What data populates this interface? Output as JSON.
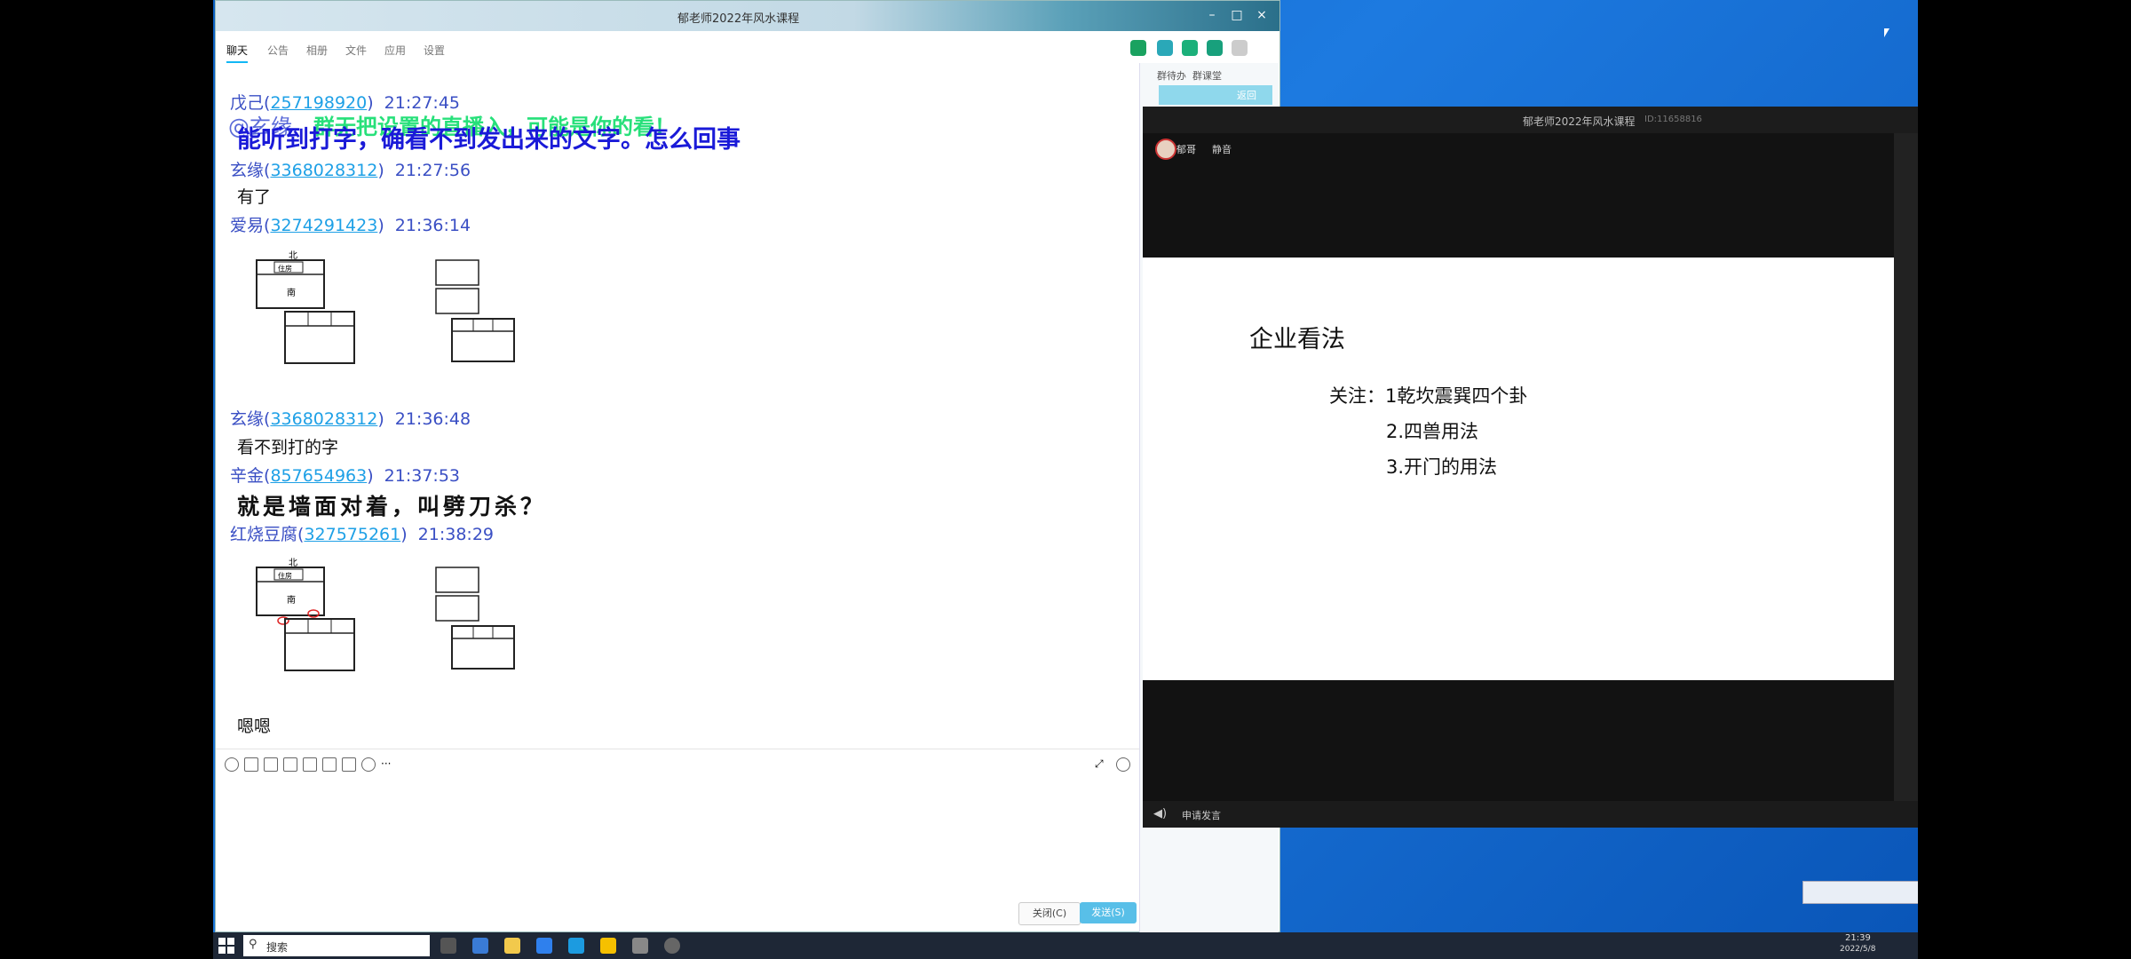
{
  "chat_window": {
    "title": "郁老师2022年风水课程",
    "tabs": [
      "聊天",
      "公告",
      "相册",
      "文件",
      "应用",
      "设置"
    ],
    "right_panel": {
      "tab1": "群待办",
      "tab2": "群课堂",
      "card_label": "返回"
    },
    "banner_mention": "@玄缘",
    "banner_text": "群无把设置的直播入，可能是你的看！",
    "messages": [
      {
        "sender": "戊己",
        "qq": "257198920",
        "time": "21:27:45",
        "text": "能听到打字，确看不到发出来的文字。怎么回事"
      },
      {
        "sender": "玄缘",
        "qq": "3368028312",
        "time": "21:27:56",
        "text": "有了"
      },
      {
        "sender": "爱易",
        "qq": "3274291423",
        "time": "21:36:14",
        "text": ""
      },
      {
        "sender": "玄缘",
        "qq": "3368028312",
        "time": "21:36:48",
        "text": "看不到打的字"
      },
      {
        "sender": "辛金",
        "qq": "857654963",
        "time": "21:37:53",
        "text": "就是墙面对着，叫劈刀杀？"
      },
      {
        "sender": "红烧豆腐",
        "qq": "327575261",
        "time": "21:38:29",
        "text": "嗯嗯"
      }
    ],
    "sketch_labels": {
      "north": "北",
      "south": "南",
      "inner": "住房"
    },
    "buttons": {
      "close": "关闭(C)",
      "send": "发送(S)"
    }
  },
  "video_window": {
    "title": "郁老师2022年风水课程",
    "id": "ID:11658816",
    "host": "郁哥",
    "pin_label": "静音",
    "call_label": "申请发言",
    "slide": {
      "title": "企业看法",
      "line1": "关注：1乾坎震巽四个卦",
      "line2": "2.四兽用法",
      "line3": "3.开门的用法"
    }
  },
  "taskbar": {
    "search_placeholder": "搜索",
    "time": "21:39",
    "date": "2022/5/8"
  },
  "colors": {
    "accent": "#12b7f5",
    "sender": "#3a4fc4",
    "qq_link": "#1ea0e6",
    "big_msg": "#1a1ad8"
  }
}
